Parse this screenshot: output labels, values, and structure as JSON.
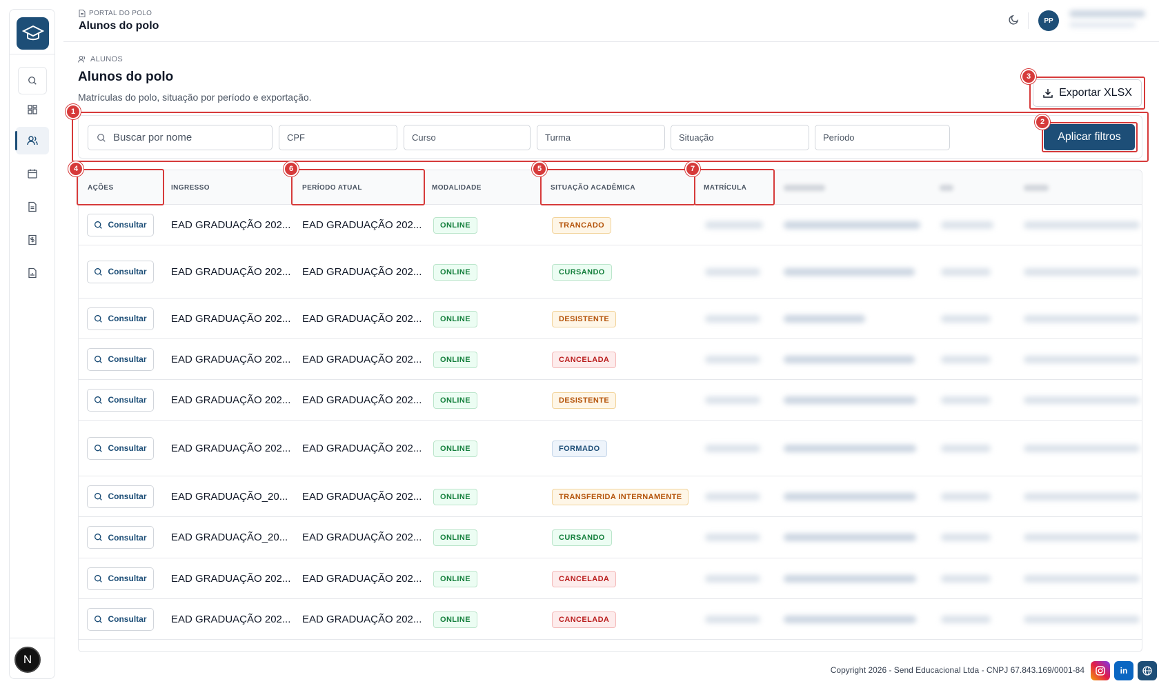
{
  "header": {
    "breadcrumb": "PORTAL DO POLO",
    "title": "Alunos do polo",
    "avatar_initials": "PP"
  },
  "section": {
    "breadcrumb": "ALUNOS",
    "title": "Alunos do polo",
    "subtitle": "Matrículas do polo, situação por período e exportação."
  },
  "actions": {
    "export_label": "Exportar XLSX",
    "apply_label": "Aplicar filtros"
  },
  "filters": {
    "search_placeholder": "Buscar por nome",
    "cpf_placeholder": "CPF",
    "curso_placeholder": "Curso",
    "turma_placeholder": "Turma",
    "situacao_placeholder": "Situação",
    "periodo_placeholder": "Período"
  },
  "table": {
    "columns": [
      "AÇÕES",
      "INGRESSO",
      "PERÍODO ATUAL",
      "MODALIDADE",
      "SITUAÇÃO ACADÊMICA",
      "MATRÍCULA"
    ],
    "action_label": "Consultar",
    "rows": [
      {
        "ingresso": "EAD GRADUAÇÃO 202...",
        "periodo": "EAD GRADUAÇÃO 202...",
        "modalidade": "ONLINE",
        "situacao": "TRANCADO"
      },
      {
        "ingresso": "EAD GRADUAÇÃO 202...",
        "periodo": "EAD GRADUAÇÃO 202...",
        "modalidade": "ONLINE",
        "situacao": "CURSANDO"
      },
      {
        "ingresso": "EAD GRADUAÇÃO 202...",
        "periodo": "EAD GRADUAÇÃO 202...",
        "modalidade": "ONLINE",
        "situacao": "DESISTENTE"
      },
      {
        "ingresso": "EAD GRADUAÇÃO 202...",
        "periodo": "EAD GRADUAÇÃO 202...",
        "modalidade": "ONLINE",
        "situacao": "CANCELADA"
      },
      {
        "ingresso": "EAD GRADUAÇÃO 202...",
        "periodo": "EAD GRADUAÇÃO 202...",
        "modalidade": "ONLINE",
        "situacao": "DESISTENTE"
      },
      {
        "ingresso": "EAD GRADUAÇÃO 202...",
        "periodo": "EAD GRADUAÇÃO 202...",
        "modalidade": "ONLINE",
        "situacao": "FORMADO"
      },
      {
        "ingresso": "EAD GRADUAÇÃO_20...",
        "periodo": "EAD GRADUAÇÃO 202...",
        "modalidade": "ONLINE",
        "situacao": "TRANSFERIDA INTERNAMENTE"
      },
      {
        "ingresso": "EAD GRADUAÇÃO_20...",
        "periodo": "EAD GRADUAÇÃO 202...",
        "modalidade": "ONLINE",
        "situacao": "CURSANDO"
      },
      {
        "ingresso": "EAD GRADUAÇÃO 202...",
        "periodo": "EAD GRADUAÇÃO 202...",
        "modalidade": "ONLINE",
        "situacao": "CANCELADA"
      },
      {
        "ingresso": "EAD GRADUAÇÃO 202...",
        "periodo": "EAD GRADUAÇÃO 202...",
        "modalidade": "ONLINE",
        "situacao": "CANCELADA"
      }
    ]
  },
  "annotations": [
    "1",
    "2",
    "3",
    "4",
    "5",
    "6",
    "7"
  ],
  "sidebar": {
    "icons": [
      "search-icon",
      "dashboard-icon",
      "users-icon",
      "calendar-icon",
      "document-icon",
      "finance-icon",
      "report-icon"
    ],
    "bottom_badge": "N"
  },
  "footer": {
    "copyright": "Copyright 2026 - Send Educacional Ltda - CNPJ 67.843.169/0001-84",
    "social": [
      "instagram-icon",
      "linkedin-icon",
      "globe-icon"
    ]
  },
  "colors": {
    "brand": "#1d4e77",
    "annotation": "#d63a3a"
  }
}
